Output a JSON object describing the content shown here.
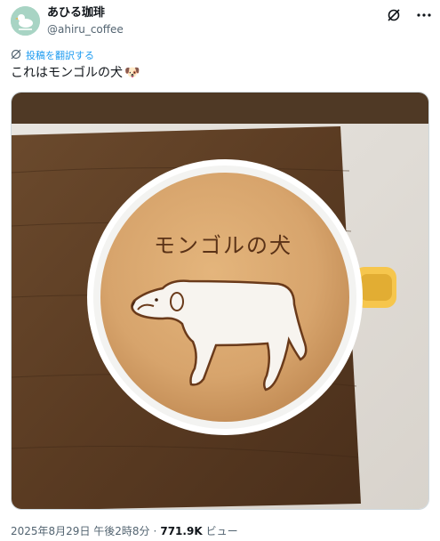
{
  "author": {
    "display_name": "あひる珈琲",
    "handle": "@ahiru_coffee"
  },
  "translate_link": "投稿を翻訳する",
  "tweet": {
    "text": "これはモンゴルの犬",
    "emoji": "🐶"
  },
  "latte_art_text": "モンゴルの犬",
  "meta": {
    "timestamp": "2025年8月29日 午後2時8分",
    "separator": "·",
    "views_count": "771.9K",
    "views_label": "ビュー"
  },
  "icons": {
    "grok": "grok-icon",
    "more": "more-icon",
    "translate": "translate-icon"
  },
  "colors": {
    "link_blue": "#1d9bf0",
    "secondary_text": "#536471",
    "avatar_bg": "#a8d4c4",
    "mug_yellow": "#f6c64d",
    "foam": "#d7a46c"
  }
}
